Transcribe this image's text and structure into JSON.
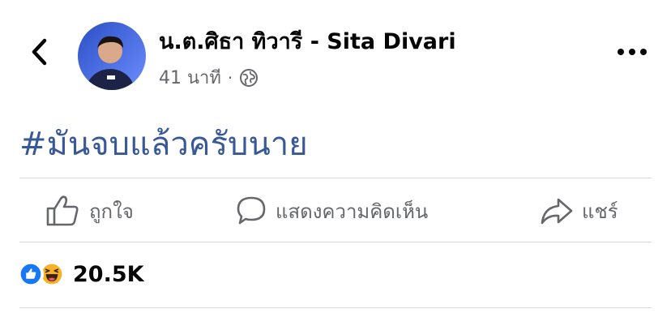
{
  "post": {
    "author": "น.ต.ศิธา ทิวารี - Sita Divari",
    "time": "41 นาที",
    "separator": "·",
    "text": "#มันจบแล้วครับนาย"
  },
  "actions": {
    "like_label": "ถูกใจ",
    "comment_label": "แสดงความคิดเห็น",
    "share_label": "แชร์"
  },
  "reactions": {
    "count": "20.5K",
    "types": [
      "like",
      "haha"
    ]
  },
  "icons": {
    "back": "back-chevron-icon",
    "more": "more-dots-icon",
    "privacy": "globe-icon",
    "like": "thumbs-up-icon",
    "comment": "comment-bubble-icon",
    "share": "share-arrow-icon"
  },
  "colors": {
    "link": "#385898",
    "secondary_text": "#65676b",
    "like_blue": "#1877f2",
    "haha_yellow": "#f7b125"
  }
}
